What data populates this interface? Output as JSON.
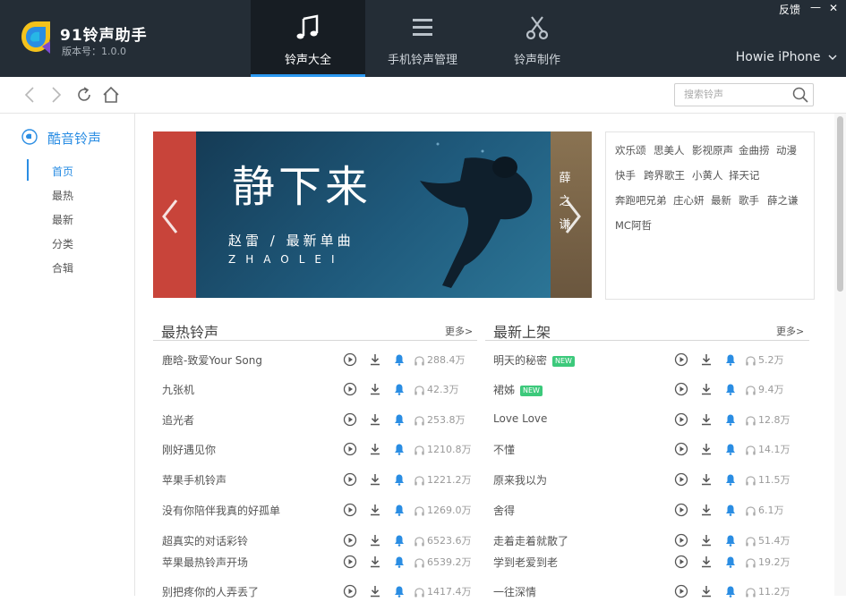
{
  "header": {
    "app_name": "91铃声助手",
    "version": "版本号：1.0.0",
    "tabs": [
      {
        "label": "铃声大全",
        "icon": "music-note-icon"
      },
      {
        "label": "手机铃声管理",
        "icon": "list-icon"
      },
      {
        "label": "铃声制作",
        "icon": "scissors-icon"
      }
    ],
    "feedback": "反馈",
    "minimize": "—",
    "close": "✕",
    "device": "Howie iPhone",
    "accent": "#2b98f0"
  },
  "search": {
    "placeholder": "搜索铃声"
  },
  "sidebar": {
    "title": "酷音铃声",
    "items": [
      "首页",
      "最热",
      "最新",
      "分类",
      "合辑"
    ]
  },
  "banner": {
    "title": "静下来",
    "subtitle": "赵雷 / 最新单曲",
    "pinyin": "ZHAOLEI",
    "side_text": "薛之谦"
  },
  "tags": [
    [
      "欢乐颂",
      "思美人",
      "影视原声",
      "金曲捞",
      "动漫"
    ],
    [
      "快手",
      "跨界歌王",
      "小黄人",
      "择天记"
    ],
    [
      "奔跑吧兄弟",
      "庄心妍",
      "最新",
      "歌手",
      "薛之谦"
    ],
    [
      "MC阿哲"
    ]
  ],
  "hot": {
    "title": "最热铃声",
    "more": "更多>",
    "rows": [
      {
        "name": "鹿晗-致爱Your Song",
        "count": "288.4万",
        "new": false
      },
      {
        "name": "九张机",
        "count": "42.3万",
        "new": false
      },
      {
        "name": "追光者",
        "count": "253.8万",
        "new": false
      },
      {
        "name": "刚好遇见你",
        "count": "1210.8万",
        "new": false
      },
      {
        "name": "苹果手机铃声",
        "count": "1221.2万",
        "new": false
      },
      {
        "name": "没有你陪伴我真的好孤单",
        "count": "1269.0万",
        "new": false
      },
      {
        "name": "超真实的对话彩铃",
        "count": "6523.6万",
        "new": false
      },
      {
        "name": "苹果最热铃声开场",
        "count": "6539.2万",
        "new": false
      },
      {
        "name": "别把疼你的人弄丢了",
        "count": "1417.4万",
        "new": false
      }
    ]
  },
  "latest": {
    "title": "最新上架",
    "more": "更多>",
    "rows": [
      {
        "name": "明天的秘密",
        "count": "5.2万",
        "new": true
      },
      {
        "name": "裙姊",
        "count": "9.4万",
        "new": true
      },
      {
        "name": "Love Love",
        "count": "12.8万",
        "new": false
      },
      {
        "name": "不懂",
        "count": "14.1万",
        "new": false
      },
      {
        "name": "原来我以为",
        "count": "11.5万",
        "new": false
      },
      {
        "name": "舍得",
        "count": "6.1万",
        "new": false
      },
      {
        "name": "走着走着就散了",
        "count": "51.4万",
        "new": false
      },
      {
        "name": "学到老爱到老",
        "count": "19.2万",
        "new": false
      },
      {
        "name": "一往深情",
        "count": "11.2万",
        "new": false
      }
    ]
  },
  "new_badge": "NEW"
}
